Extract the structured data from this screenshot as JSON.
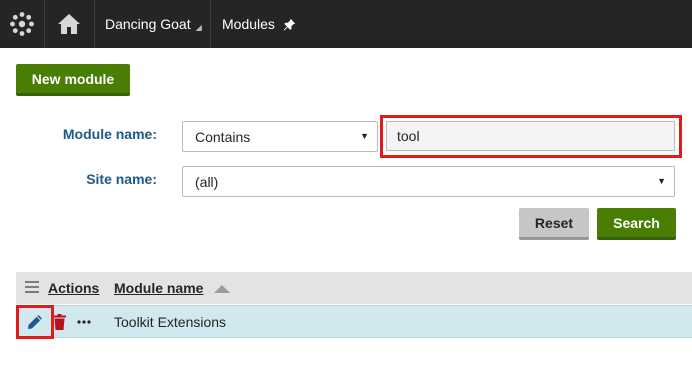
{
  "header": {
    "logo_icon": "kentico-gear-icon",
    "home_icon": "home-icon",
    "site_name": "Dancing Goat",
    "site_caret": "◢",
    "breadcrumb": "Modules",
    "pin_icon": "pin-icon"
  },
  "toolbar": {
    "new_module_label": "New module"
  },
  "filter": {
    "module_name_label": "Module name:",
    "module_name_operator": "Contains",
    "module_name_value": "tool",
    "site_name_label": "Site name:",
    "site_name_value": "(all)",
    "reset_label": "Reset",
    "search_label": "Search"
  },
  "grid": {
    "columns": {
      "actions": "Actions",
      "module_name": "Module name"
    },
    "rows": [
      {
        "module_name": "Toolkit Extensions",
        "actions": [
          "edit-icon",
          "delete-icon",
          "more-icon"
        ]
      }
    ]
  },
  "colors": {
    "header_bg": "#262524",
    "primary_green": "#497d04",
    "label_blue": "#1c5a8b",
    "highlight_red": "#e01b1b",
    "row_selected": "#d1e8ee"
  }
}
